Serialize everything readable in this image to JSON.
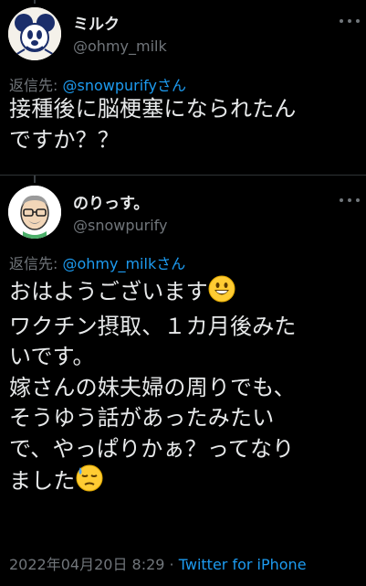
{
  "tweets": [
    {
      "name": "ミルク",
      "handle": "@ohmy_milk",
      "reply_prefix": "返信先: ",
      "reply_mention": "@snowpurify",
      "reply_suffix": "さん",
      "text": "接種後に脳梗塞になられたん\nですか？？",
      "avatar_icon": "mickey-mouse-sketch-avatar"
    },
    {
      "name": "のりっす。",
      "handle": "@snowpurify",
      "reply_prefix": "返信先: ",
      "reply_mention": "@ohmy_milk",
      "reply_suffix": "さん",
      "text_line1": "おはようございます",
      "text_rest": "\nワクチン摂取、１カ月後みた\nいです。\n嫁さんの妹夫婦の周りでも、\nそうゆう話があったみたい\nで、やっぱりかぁ？ってなり\nました",
      "emoji1": "grinning-face-emoji",
      "emoji2": "downcast-sweat-face-emoji",
      "avatar_icon": "cartoon-man-glasses-avatar",
      "date": "2022年04月20日 8:29",
      "separator": " · ",
      "source": "Twitter for iPhone"
    }
  ],
  "colors": {
    "background": "#000000",
    "text": "#e7e9ea",
    "muted": "#71767b",
    "accent": "#1d9bf0"
  }
}
